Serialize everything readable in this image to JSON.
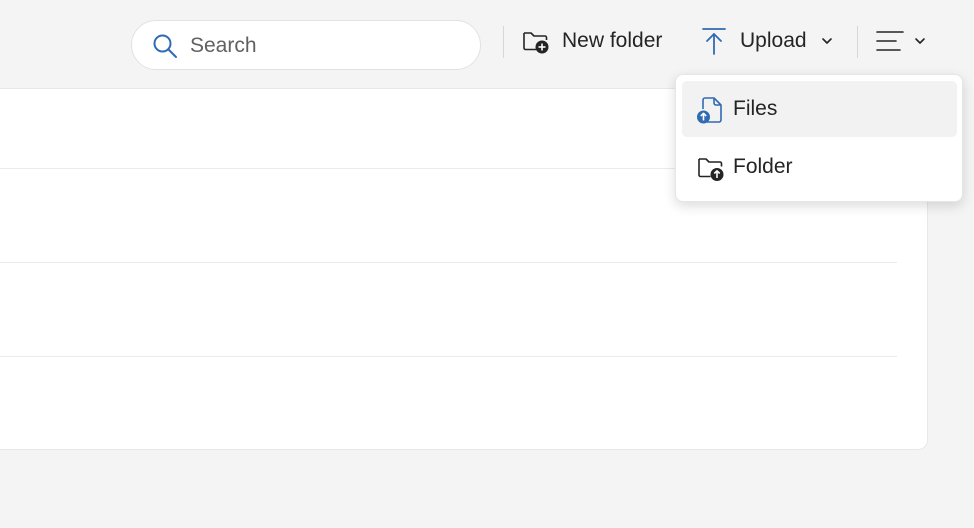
{
  "toolbar": {
    "search": {
      "placeholder": "Search",
      "value": ""
    },
    "new_folder_label": "New folder",
    "upload_label": "Upload"
  },
  "upload_menu": {
    "items": [
      {
        "label": "Files",
        "icon": "file-upload-icon",
        "selected": true
      },
      {
        "label": "Folder",
        "icon": "folder-upload-icon",
        "selected": false
      }
    ]
  },
  "colors": {
    "accent": "#2f6ab3",
    "background": "#f4f4f4",
    "surface": "#ffffff",
    "text": "#242424"
  }
}
